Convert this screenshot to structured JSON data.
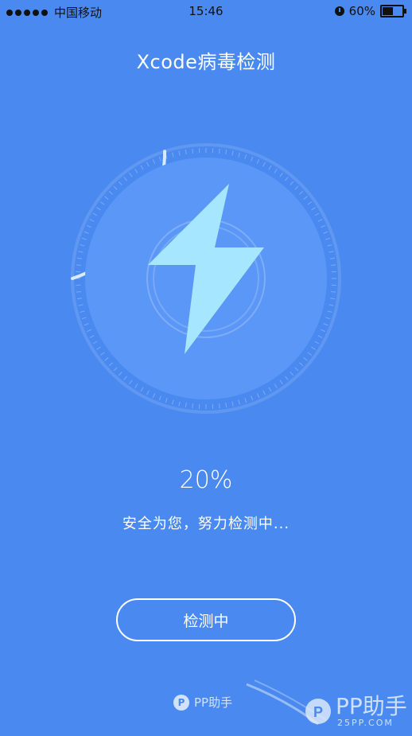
{
  "status_bar": {
    "carrier": "中国移动",
    "time": "15:46",
    "battery_text": "60%",
    "battery_level": 0.6,
    "signal_icon": "signal-dots-icon",
    "alarm_icon": "alarm-icon",
    "battery_icon": "battery-icon"
  },
  "header": {
    "title": "Xcode病毒检测"
  },
  "scanner": {
    "icon": "lightning-bolt-icon",
    "progress": 0.2,
    "colors": {
      "background": "#4a8af0",
      "inner_circle": "#5b97f7",
      "bolt": "#a6e6ff",
      "progress_arc": "#d8ecff"
    }
  },
  "progress": {
    "percent_text": "20%",
    "status_text": "安全为您，努力检测中..."
  },
  "action": {
    "button_label": "检测中"
  },
  "footer": {
    "brand_badge": "P",
    "brand_name": "PP助手"
  },
  "watermark": {
    "text": "PP助手",
    "subtext": "25PP.COM"
  }
}
